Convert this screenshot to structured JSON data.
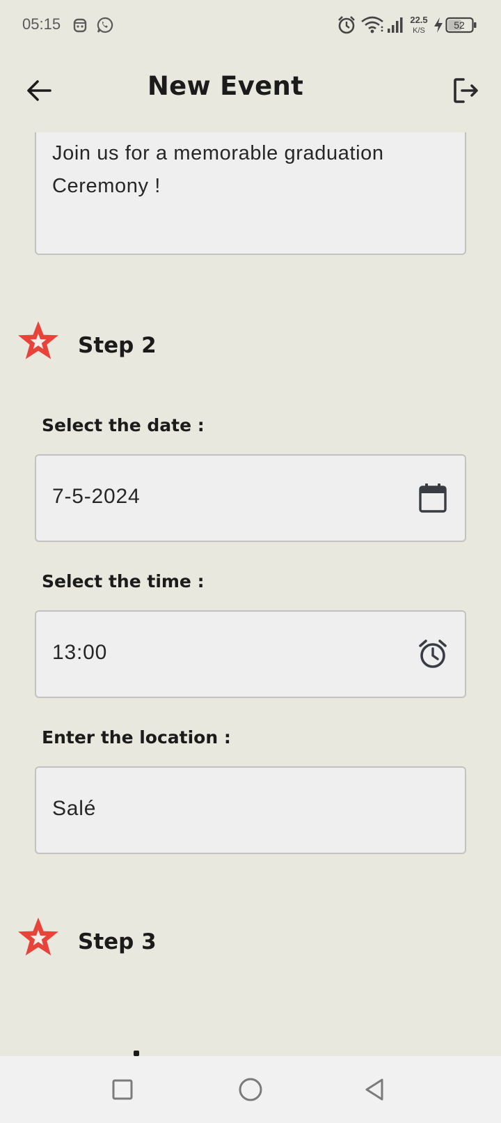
{
  "status_bar": {
    "time": "05:15",
    "net_speed_value": "22.5",
    "net_speed_unit": "K/S",
    "battery": "52",
    "icons": [
      "notification-icon",
      "whatsapp-icon",
      "alarm-icon",
      "wifi-icon",
      "signal-icon",
      "charging-icon",
      "battery-icon"
    ]
  },
  "app_bar": {
    "title": "New Event",
    "back_icon": "arrow-left-icon",
    "logout_icon": "logout-icon"
  },
  "description": {
    "text": "Join us for a memorable graduation Ceremony !"
  },
  "step2": {
    "label": "Step 2",
    "date_label": "Select the date :",
    "date_value": "7-5-2024",
    "date_icon": "calendar-icon",
    "time_label": "Select the time :",
    "time_value": "13:00",
    "time_icon": "alarm-clock-icon",
    "location_label": "Enter the location :",
    "location_value": "Salé"
  },
  "step3": {
    "label": "Step 3"
  },
  "nav_bar": {
    "icons": [
      "recents-square-icon",
      "home-circle-icon",
      "back-triangle-icon"
    ]
  },
  "colors": {
    "background": "#E9E8DE",
    "field_background": "#EFEFEF",
    "star_accent": "#E8433A",
    "text": "#1B1B1B"
  }
}
